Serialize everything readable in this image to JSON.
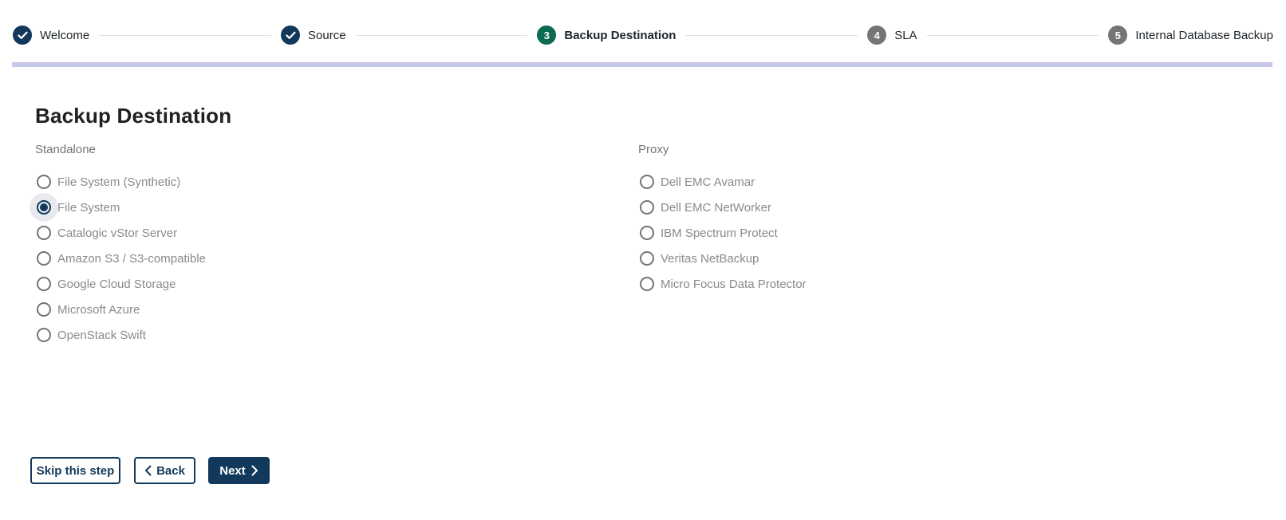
{
  "stepper": {
    "steps": [
      {
        "label": "Welcome",
        "state": "completed",
        "number": ""
      },
      {
        "label": "Source",
        "state": "completed",
        "number": ""
      },
      {
        "label": "Backup Destination",
        "state": "active",
        "number": "3"
      },
      {
        "label": "SLA",
        "state": "pending",
        "number": "4"
      },
      {
        "label": "Internal Database Backup",
        "state": "pending",
        "number": "5"
      }
    ]
  },
  "page": {
    "title": "Backup Destination"
  },
  "groups": [
    {
      "label": "Standalone",
      "options": [
        {
          "label": "File System (Synthetic)",
          "selected": false
        },
        {
          "label": "File System",
          "selected": true
        },
        {
          "label": "Catalogic vStor Server",
          "selected": false
        },
        {
          "label": "Amazon S3 / S3-compatible",
          "selected": false
        },
        {
          "label": "Google Cloud Storage",
          "selected": false
        },
        {
          "label": "Microsoft Azure",
          "selected": false
        },
        {
          "label": "OpenStack Swift",
          "selected": false
        }
      ]
    },
    {
      "label": "Proxy",
      "options": [
        {
          "label": "Dell EMC Avamar",
          "selected": false
        },
        {
          "label": "Dell EMC NetWorker",
          "selected": false
        },
        {
          "label": "IBM Spectrum Protect",
          "selected": false
        },
        {
          "label": "Veritas NetBackup",
          "selected": false
        },
        {
          "label": "Micro Focus Data Protector",
          "selected": false
        }
      ]
    }
  ],
  "buttons": {
    "skip": "Skip this step",
    "back": "Back",
    "next": "Next"
  },
  "colors": {
    "navy": "#12395b",
    "active_green": "#0b6b52",
    "pending_gray": "#757575",
    "progress_track": "#c7c8e9"
  }
}
